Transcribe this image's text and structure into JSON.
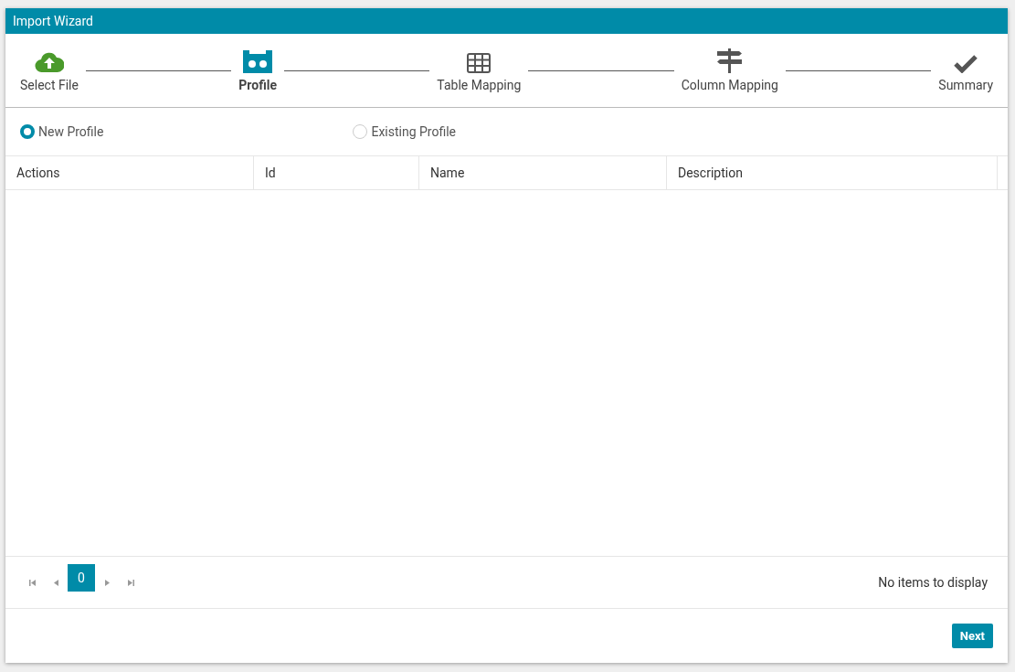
{
  "window": {
    "title": "Import Wizard"
  },
  "steps": [
    {
      "label": "Select File",
      "kind": "upload",
      "done": true,
      "selected": false
    },
    {
      "label": "Profile",
      "kind": "profile",
      "done": false,
      "selected": true
    },
    {
      "label": "Table Mapping",
      "kind": "table",
      "done": false,
      "selected": false
    },
    {
      "label": "Column Mapping",
      "kind": "signpost",
      "done": false,
      "selected": false
    },
    {
      "label": "Summary",
      "kind": "check",
      "done": false,
      "selected": false
    }
  ],
  "profile_options": [
    {
      "label": "New Profile",
      "selected": true
    },
    {
      "label": "Existing Profile",
      "selected": false
    }
  ],
  "table": {
    "columns": [
      "Actions",
      "Id",
      "Name",
      "Description"
    ]
  },
  "pager": {
    "pages": [
      {
        "label": "0",
        "selected": true
      }
    ],
    "status": "No items to display"
  },
  "buttons": [
    "Next"
  ]
}
